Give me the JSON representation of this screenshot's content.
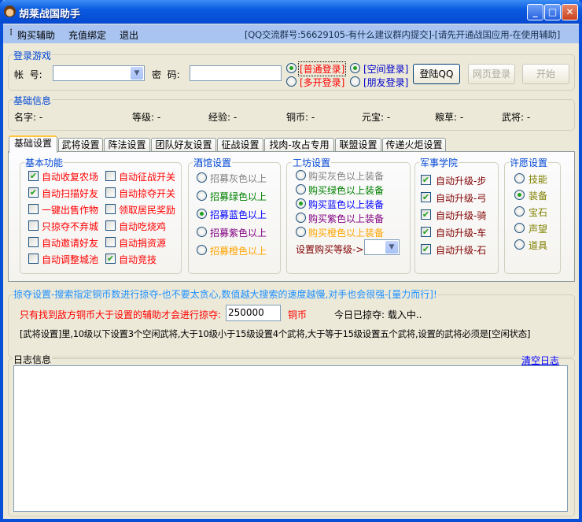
{
  "window": {
    "title": "胡莱战国助手"
  },
  "menu": {
    "items": [
      "购买辅助",
      "充值绑定",
      "退出"
    ],
    "info": "[QQ交流群号:56629105-有什么建议群内提交]-[请先开通战国应用-在使用辅助]"
  },
  "login": {
    "group": "登录游戏",
    "account_label": "帐  号:",
    "account_value": "",
    "password_label": "密  码:",
    "password_value": "",
    "modes": [
      {
        "label": "[普通登录]",
        "checked": true
      },
      {
        "label": "[多开登录]",
        "checked": false
      }
    ],
    "platforms": [
      {
        "label": "[空间登录]",
        "checked": true
      },
      {
        "label": "[朋友登录]",
        "checked": false
      }
    ],
    "buttons": {
      "qq": "登陆QQ",
      "web": "网页登录",
      "start": "开始"
    }
  },
  "basic_info": {
    "group": "基础信息",
    "fields": [
      {
        "label": "名字:",
        "value": "-"
      },
      {
        "label": "等级:",
        "value": "-"
      },
      {
        "label": "经验:",
        "value": "-"
      },
      {
        "label": "铜币:",
        "value": "-"
      },
      {
        "label": "元宝:",
        "value": "-"
      },
      {
        "label": "粮草:",
        "value": "-"
      },
      {
        "label": "武将:",
        "value": "-"
      }
    ]
  },
  "tabs": [
    "基础设置",
    "武将设置",
    "阵法设置",
    "团队好友设置",
    "征战设置",
    "找肉-攻占专用",
    "联盟设置",
    "传递火炬设置"
  ],
  "basic_functions": {
    "group": "基本功能",
    "items": [
      {
        "label": "自动收复农场",
        "checked": true
      },
      {
        "label": "自动征战开关",
        "checked": false
      },
      {
        "label": "自动扫描好友",
        "checked": true
      },
      {
        "label": "自动掠夺开关",
        "checked": false
      },
      {
        "label": "一键出售作物",
        "checked": false
      },
      {
        "label": "领取居民奖励",
        "checked": false
      },
      {
        "label": "只掠夺不弃城",
        "checked": false
      },
      {
        "label": "自动吃烧鸡",
        "checked": false
      },
      {
        "label": "自动邀请好友",
        "checked": false
      },
      {
        "label": "自动捐资源",
        "checked": false
      },
      {
        "label": "自动调整城池",
        "checked": false
      },
      {
        "label": "自动竞技",
        "checked": true
      }
    ]
  },
  "tavern": {
    "group": "酒馆设置",
    "options": [
      {
        "label": "招募灰色以上",
        "color": "#808080",
        "checked": false
      },
      {
        "label": "招募绿色以上",
        "color": "#008000",
        "checked": false
      },
      {
        "label": "招募蓝色以上",
        "color": "#0000ff",
        "checked": true
      },
      {
        "label": "招募紫色以上",
        "color": "#800080",
        "checked": false
      },
      {
        "label": "招募橙色以上",
        "color": "#ffa500",
        "checked": false
      }
    ]
  },
  "workshop": {
    "group": "工坊设置",
    "options": [
      {
        "label": "购买灰色以上装备",
        "color": "#808080",
        "checked": false
      },
      {
        "label": "购买绿色以上装备",
        "color": "#008000",
        "checked": false
      },
      {
        "label": "购买蓝色以上装备",
        "color": "#0000ff",
        "checked": true
      },
      {
        "label": "购买紫色以上装备",
        "color": "#800080",
        "checked": false
      },
      {
        "label": "购买橙色以上装备",
        "color": "#ffa500",
        "checked": false
      }
    ],
    "level_label": "设置购买等级->",
    "level_value": ""
  },
  "academy": {
    "group": "军事学院",
    "items": [
      {
        "label": "自动升级-步",
        "checked": true
      },
      {
        "label": "自动升级-弓",
        "checked": true
      },
      {
        "label": "自动升级-骑",
        "checked": true
      },
      {
        "label": "自动升级-车",
        "checked": true
      },
      {
        "label": "自动升级-石",
        "checked": true
      }
    ]
  },
  "wish": {
    "group": "许愿设置",
    "options": [
      {
        "label": "技能",
        "checked": false
      },
      {
        "label": "装备",
        "checked": true
      },
      {
        "label": "宝石",
        "checked": false
      },
      {
        "label": "声望",
        "checked": false
      },
      {
        "label": "道具",
        "checked": false
      }
    ]
  },
  "plunder": {
    "group": "掠夺设置-搜索指定铜币数进行掠夺-也不要太贪心,数值越大搜索的速度越慢,对手也会很强-[量力而行]!",
    "threshold_label": "只有找到敌方铜币大于设置的辅助才会进行掠夺:",
    "threshold_value": "250000",
    "unit": "铜币",
    "today": "今日已掠夺: 载入中..",
    "note": "[武将设置]里,10级以下设置3个空闲武将,大于10级小于15级设置4个武将,大于等于15级设置五个武将,设置的武将必须是[空闲状态]"
  },
  "log": {
    "group": "日志信息",
    "clear": "清空日志",
    "content": ""
  }
}
